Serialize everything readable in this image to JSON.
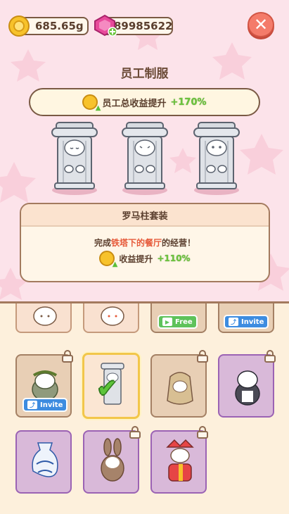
{
  "currency": {
    "gold": "685.65g",
    "gems": "89985622"
  },
  "header": {
    "title": "员工制服",
    "close_icon": "close-icon"
  },
  "bonus": {
    "label": "员工总收益提升",
    "value": "+170%"
  },
  "suit": {
    "name": "罗马柱套装",
    "desc_prefix": "完成",
    "desc_place": "铁塔下的餐厅",
    "desc_suffix": "的经营！",
    "bonus_label": "收益提升",
    "bonus_value": "+110%"
  },
  "grid": {
    "free_label": "Free",
    "invite_label": "Invite"
  },
  "colors": {
    "accent_green": "#6cc43d",
    "highlight_red": "#e65a3a",
    "locked_purple": "#9b63b4"
  }
}
